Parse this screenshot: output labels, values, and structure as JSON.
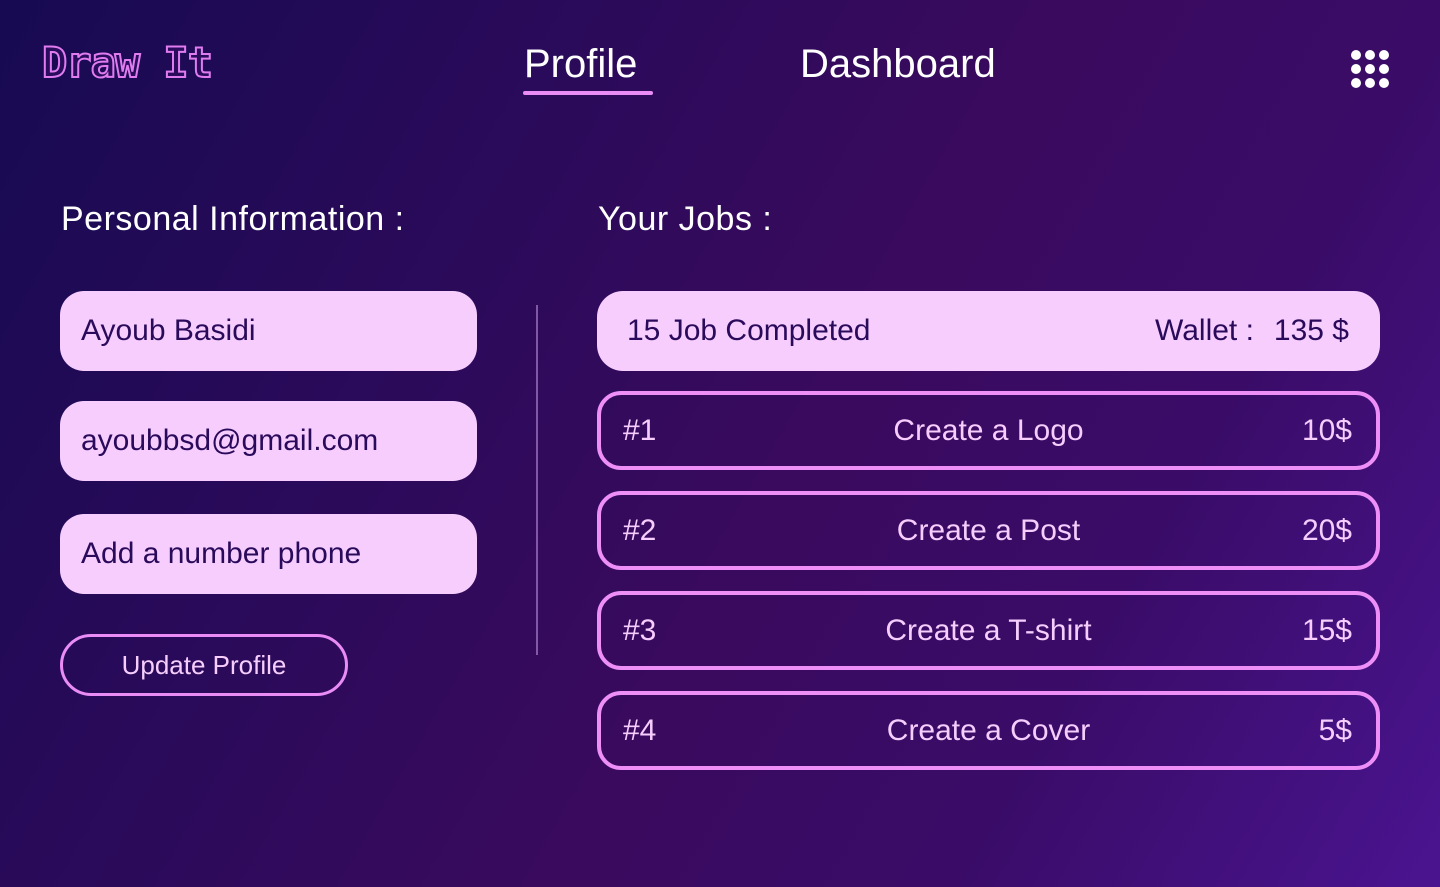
{
  "header": {
    "logo_text": "Draw It",
    "tabs": [
      {
        "label": "Profile",
        "active": true
      },
      {
        "label": "Dashboard",
        "active": false
      }
    ],
    "menu_icon": "grid-dots-icon"
  },
  "personal": {
    "title": "Personal Information :",
    "name_value": "Ayoub Basidi",
    "email_value": "ayoubbsd@gmail.com",
    "phone_placeholder": "Add a number phone",
    "update_label": "Update Profile"
  },
  "jobs": {
    "title": "Your Jobs :",
    "completed_text": "15 Job Completed",
    "wallet_label": "Wallet :",
    "wallet_value": "135 $",
    "items": [
      {
        "num": "#1",
        "title": "Create a Logo",
        "price": "10$"
      },
      {
        "num": "#2",
        "title": "Create a Post",
        "price": "20$"
      },
      {
        "num": "#3",
        "title": "Create a T-shirt",
        "price": "15$"
      },
      {
        "num": "#4",
        "title": "Create a Cover",
        "price": "5$"
      }
    ]
  },
  "colors": {
    "background_start": "#170a52",
    "background_end": "#4a1490",
    "accent": "#e98cf6",
    "field_bg": "#f6cdfd",
    "field_text": "#2a0a5a"
  }
}
